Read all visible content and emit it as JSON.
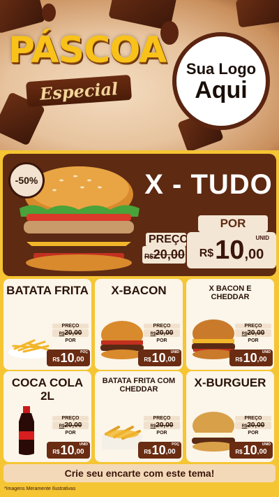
{
  "header": {
    "title": "PÁSCOA",
    "subtitle": "Especial",
    "logo_line1": "Sua Logo",
    "logo_line2": "Aqui"
  },
  "feature": {
    "discount": "-50%",
    "title": "X - TUDO",
    "por_label": "POR",
    "preco_label": "PREÇO",
    "old_price_rs": "R$",
    "old_price": "20,00",
    "price_rs": "R$",
    "price_int": "10",
    "price_cents": ",00",
    "unit": "UNID"
  },
  "items": [
    {
      "name": "BATATA FRITA",
      "preco": "PREÇO",
      "old_rs": "R$",
      "old": "20,00",
      "por": "POR",
      "rs": "R$",
      "int": "10",
      "cents": ",00",
      "unit": "POÇ"
    },
    {
      "name": "X-BACON",
      "preco": "PREÇO",
      "old_rs": "R$",
      "old": "20,00",
      "por": "POR",
      "rs": "R$",
      "int": "10",
      "cents": ",00",
      "unit": "UNID"
    },
    {
      "name": "X BACON E CHEDDAR",
      "preco": "PREÇO",
      "old_rs": "R$",
      "old": "20,00",
      "por": "POR",
      "rs": "R$",
      "int": "10",
      "cents": ",00",
      "unit": "UNID"
    },
    {
      "name": "COCA COLA 2L",
      "preco": "PREÇO",
      "old_rs": "R$",
      "old": "20,00",
      "por": "POR",
      "rs": "R$",
      "int": "10",
      "cents": ",00",
      "unit": "UNID"
    },
    {
      "name": "BATATA FRITA COM CHEDDAR",
      "preco": "PREÇO",
      "old_rs": "R$",
      "old": "20,00",
      "por": "POR",
      "rs": "R$",
      "int": "10",
      "cents": ",00",
      "unit": "POÇ"
    },
    {
      "name": "X-BURGUER",
      "preco": "PREÇO",
      "old_rs": "R$",
      "old": "20,00",
      "por": "POR",
      "rs": "R$",
      "int": "10",
      "cents": ",00",
      "unit": "UNID"
    }
  ],
  "cta": "Crie seu encarte com este tema!",
  "footnote": "*Imagens Meramente Ilustrativas",
  "colors": {
    "background": "#f5c534",
    "chocolate": "#5e2a12",
    "gold": "#f8c21a",
    "cream": "#fbf5ea"
  }
}
